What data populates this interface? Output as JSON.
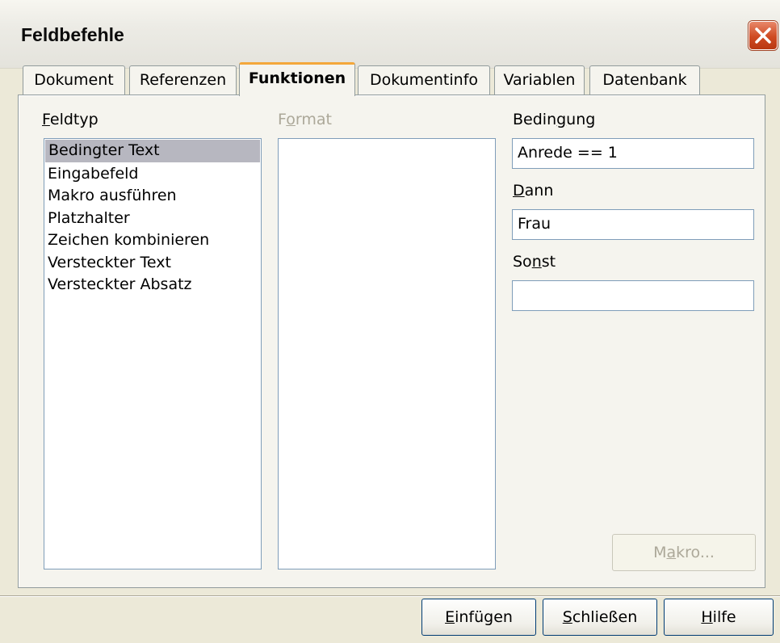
{
  "window": {
    "title": "Feldbefehle"
  },
  "tabs": [
    {
      "label": "Dokument",
      "active": false
    },
    {
      "label": "Referenzen",
      "active": false
    },
    {
      "label": "Funktionen",
      "active": true
    },
    {
      "label": "Dokumentinfo",
      "active": false
    },
    {
      "label": "Variablen",
      "active": false
    },
    {
      "label": "Datenbank",
      "active": false
    }
  ],
  "fieldtype": {
    "label_mnemonic": "F",
    "label_rest": "eldtyp",
    "items": [
      "Bedingter Text",
      "Eingabefeld",
      "Makro ausführen",
      "Platzhalter",
      "Zeichen kombinieren",
      "Versteckter Text",
      "Versteckter Absatz"
    ],
    "selected": "Bedingter Text"
  },
  "format": {
    "label_pre": "F",
    "label_mnemonic": "o",
    "label_rest": "rmat"
  },
  "condition": {
    "label_pre": "Bedin",
    "label_mnemonic": "g",
    "label_rest": "ung",
    "value": "Anrede == 1"
  },
  "then": {
    "label_mnemonic": "D",
    "label_rest": "ann",
    "value": "Frau"
  },
  "else": {
    "label_pre": "So",
    "label_mnemonic": "n",
    "label_rest": "st",
    "value": ""
  },
  "buttons": {
    "macro": {
      "pre": "M",
      "mnemonic": "a",
      "rest": "kro..."
    },
    "insert": {
      "mnemonic": "E",
      "rest": "infügen"
    },
    "close": {
      "mnemonic": "S",
      "rest": "chließen"
    },
    "help": {
      "mnemonic": "H",
      "rest": "ilfe"
    }
  },
  "icons": {
    "close": "close-icon"
  },
  "colors": {
    "accent_tab": "#f4a73b",
    "close_button": "#cf4a22",
    "selection": "#b7b7c0"
  }
}
